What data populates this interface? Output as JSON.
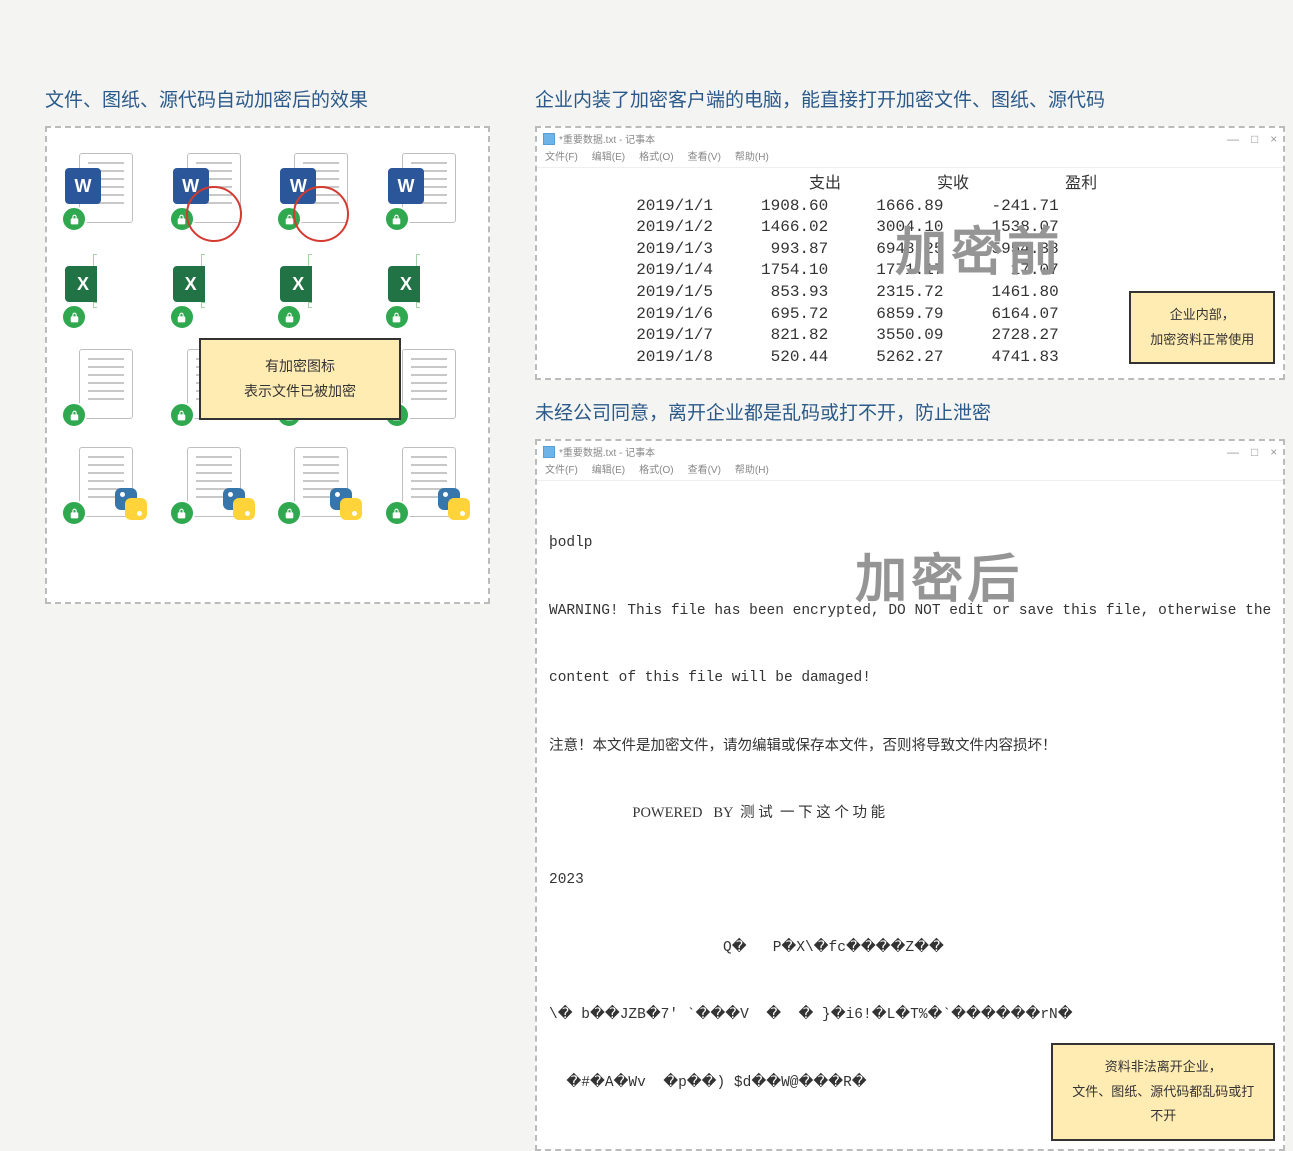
{
  "left": {
    "title": "文件、图纸、源代码自动加密后的效果",
    "label_line1": "有加密图标",
    "label_line2": "表示文件已被加密",
    "app_word_glyph": "W",
    "app_excel_glyph": "X"
  },
  "rightA": {
    "title": "企业内装了加密客户端的电脑，能直接打开加密文件、图纸、源代码",
    "window_title": "*重要数据.txt - 记事本",
    "menu": [
      "文件(F)",
      "编辑(E)",
      "格式(O)",
      "查看(V)",
      "帮助(H)"
    ],
    "watermark": "加密前",
    "note_line1": "企业内部，",
    "note_line2": "加密资料正常使用",
    "win_btn_min": "—",
    "win_btn_max": "□",
    "win_btn_close": "×"
  },
  "rightB": {
    "title": "未经公司同意，离开企业都是乱码或打不开，防止泄密",
    "window_title": "*重要数据.txt - 记事本",
    "menu": [
      "文件(F)",
      "编辑(E)",
      "格式(O)",
      "查看(V)",
      "帮助(H)"
    ],
    "watermark": "加密后",
    "note_line1": "资料非法离开企业，",
    "note_line2": "文件、图纸、源代码都乱码或打不开",
    "body_line1": "þodlp",
    "body_line2": "WARNING! This file has been encrypted, DO NOT edit or save this file, otherwise the",
    "body_line3": "content of this file will be damaged!",
    "body_line4": "注意！本文件是加密文件，请勿编辑或保存本文件，否则将导致文件内容损坏！",
    "body_line5": "                       POWERED   BY  测 试  一 下 这 个 功 能",
    "body_line6": "2023",
    "body_line7": "                    Q�   P�X\\�fc����Z��",
    "body_line8": "\\� b��JZB�7' `���V  �  � }�i6!�L�T%�`������rN�",
    "body_line9": "  �#�A�Wv  �p��) $d��W@���R�"
  },
  "chart_data": {
    "type": "table",
    "title": "",
    "columns": [
      "",
      "支出",
      "实收",
      "盈利"
    ],
    "rows": [
      [
        "2019/1/1",
        "1908.60",
        "1666.89",
        "-241.71"
      ],
      [
        "2019/1/2",
        "1466.02",
        "3004.10",
        "1538.07"
      ],
      [
        "2019/1/3",
        "993.87",
        "6948.25",
        "5954.38"
      ],
      [
        "2019/1/4",
        "1754.10",
        "1771.17",
        "17.07"
      ],
      [
        "2019/1/5",
        "853.93",
        "2315.72",
        "1461.80"
      ],
      [
        "2019/1/6",
        "695.72",
        "6859.79",
        "6164.07"
      ],
      [
        "2019/1/7",
        "821.82",
        "3550.09",
        "2728.27"
      ],
      [
        "2019/1/8",
        "520.44",
        "5262.27",
        "4741.83"
      ]
    ]
  }
}
